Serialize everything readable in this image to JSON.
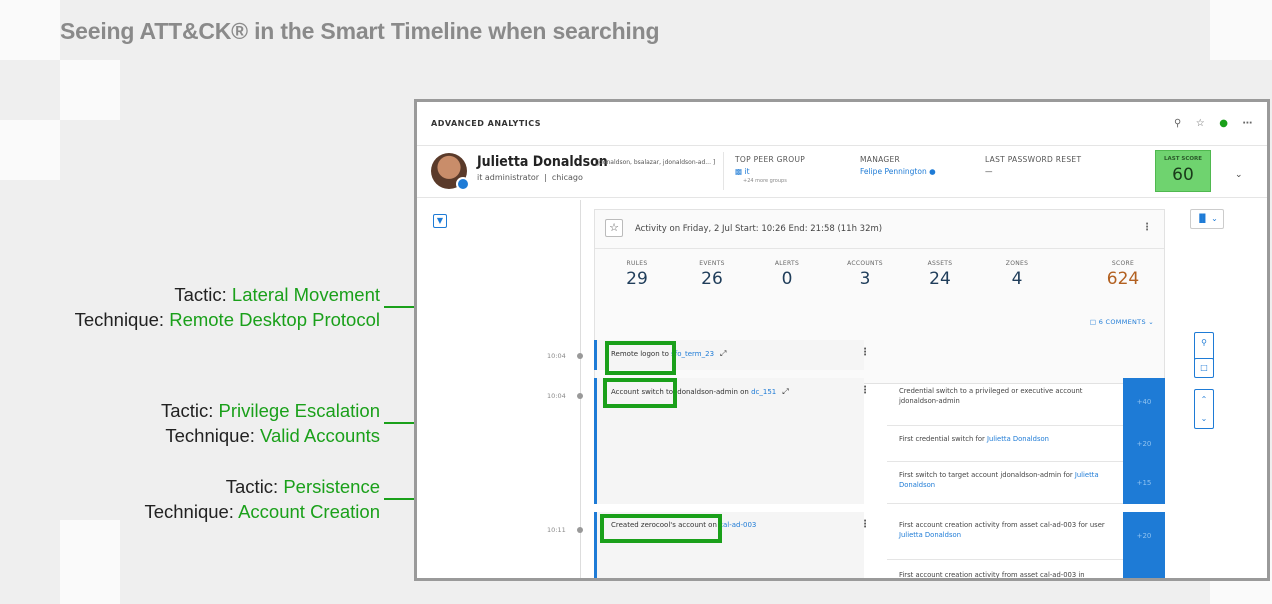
{
  "slide_title": "Seeing ATT&CK® in the Smart Timeline when searching",
  "annotations": [
    {
      "tactic_label": "Tactic: ",
      "tactic": "Lateral Movement",
      "technique_label": "Technique: ",
      "technique": "Remote Desktop Protocol"
    },
    {
      "tactic_label": "Tactic: ",
      "tactic": "Privilege Escalation",
      "technique_label": "Technique: ",
      "technique": "Valid Accounts"
    },
    {
      "tactic_label": "Tactic: ",
      "tactic": "Persistence",
      "technique_label": "Technique: ",
      "technique": "Account Creation"
    }
  ],
  "app": {
    "title": "ADVANCED ANALYTICS",
    "icons": [
      "search-icon",
      "star-icon",
      "bell-icon",
      "more-icon"
    ]
  },
  "profile": {
    "name": "Julietta Donaldson",
    "aliases": "[jdonaldson, bsalazar, jdonaldson-ad... ]",
    "role": "it administrator",
    "location": "chicago",
    "top_peer_group_label": "TOP PEER GROUP",
    "top_peer_group": "it",
    "more_groups": "+24 more groups",
    "manager_label": "MANAGER",
    "manager": "Felipe Pennington",
    "last_password_reset_label": "LAST PASSWORD RESET",
    "last_password_reset": "—",
    "last_score_label": "LAST SCORE",
    "last_score": "60"
  },
  "activity": {
    "title": "Activity on Friday, 2 Jul   Start: 10:26 End: 21:58 (11h 32m)",
    "stats": [
      {
        "label": "RULES",
        "value": "29"
      },
      {
        "label": "EVENTS",
        "value": "26"
      },
      {
        "label": "ALERTS",
        "value": "0"
      },
      {
        "label": "ACCOUNTS",
        "value": "3"
      },
      {
        "label": "ASSETS",
        "value": "24"
      },
      {
        "label": "ZONES",
        "value": "4"
      },
      {
        "label": "SCORE",
        "value": "624"
      }
    ],
    "comments": "6 COMMENTS"
  },
  "events": [
    {
      "time": "10:04",
      "text": "Remote logon to ",
      "link": "sfo_term_23"
    },
    {
      "time": "10:04",
      "text": "Account switch to jdonaldson-admin on ",
      "link": "dc_151"
    },
    {
      "time": "10:11",
      "text": "Created zerocool's account on ",
      "link": "cal-ad-003"
    }
  ],
  "reasons": [
    {
      "text": "Credential switch to a privileged or executive account jdonaldson-admin",
      "link": "",
      "points": "+40"
    },
    {
      "text": "First credential switch for ",
      "link": "Julietta Donaldson",
      "points": "+20"
    },
    {
      "text": "First switch to target account jdonaldson-admin for ",
      "link": "Julietta Donaldson",
      "points": "+15"
    },
    {
      "text": "First account creation activity from asset cal-ad-003 for user ",
      "link": "Julietta Donaldson",
      "points": "+20"
    },
    {
      "text": "First account creation activity from asset cal-ad-003 in",
      "link": "",
      "points": ""
    }
  ],
  "colors": {
    "highlight": "#1aa01a",
    "accent": "#1e7bd6",
    "score_bg": "#6fd36f"
  }
}
